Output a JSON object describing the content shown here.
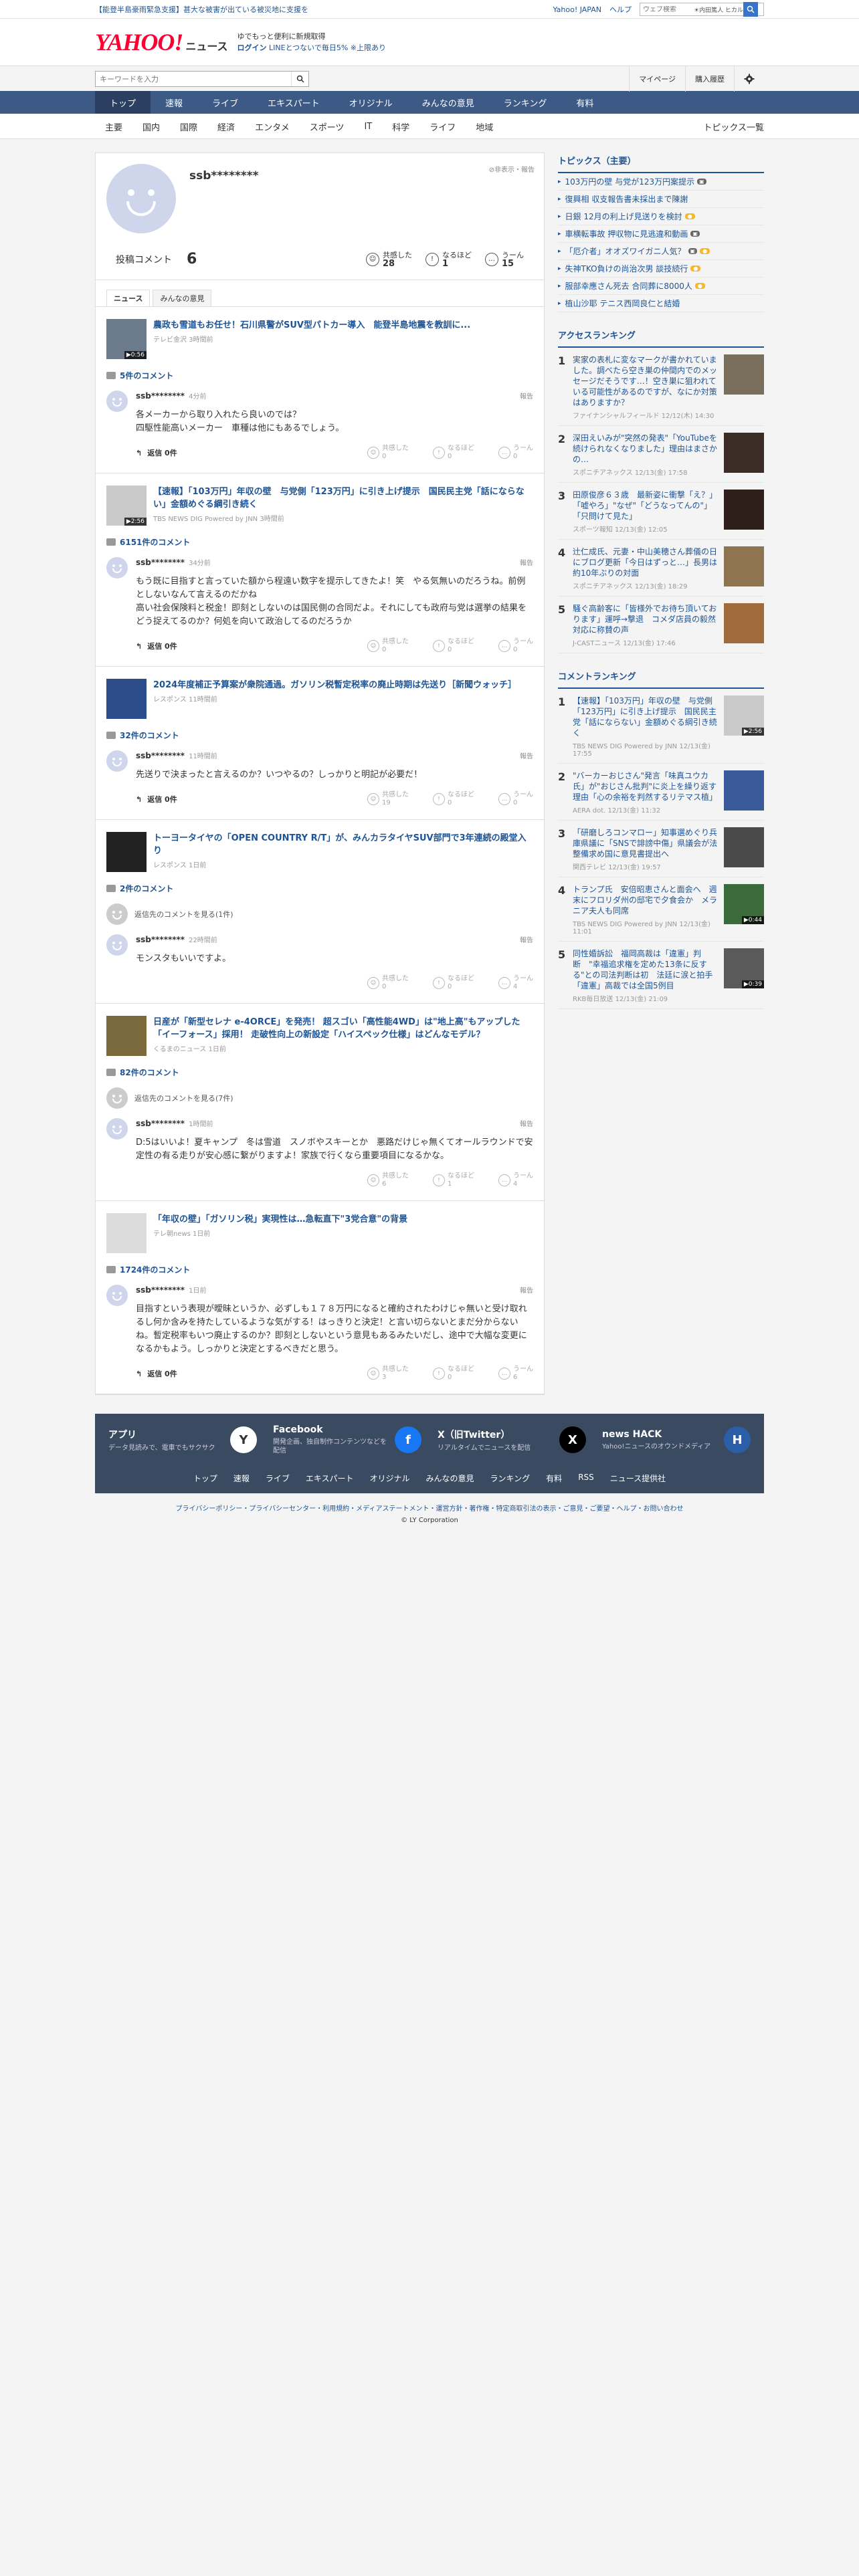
{
  "top_strip": {
    "notice": "【能登半島豪雨緊急支援】甚大な被害が出ている被災地に支援を",
    "links": [
      "Yahoo! JAPAN",
      "ヘルプ"
    ],
    "search_placeholder": "ウェブ検索",
    "search_hint": "☀内田篤人 ヒカル"
  },
  "header": {
    "logo": "YAHOO!",
    "logo_sub": "JAPAN",
    "section": "ニュース",
    "promo_line1": "ゆでもっと便利に新規取得",
    "promo_line2_login": "ログイン",
    "promo_line2": " LINEとつないで毎日5% ※上限あり"
  },
  "search": {
    "placeholder": "キーワードを入力",
    "mypage": "マイページ",
    "history": "購入履歴"
  },
  "nav": {
    "tabs": [
      "トップ",
      "速報",
      "ライブ",
      "エキスパート",
      "オリジナル",
      "みんなの意見",
      "ランキング",
      "有料"
    ],
    "active": "トップ"
  },
  "subnav": {
    "items": [
      "主要",
      "国内",
      "国際",
      "経済",
      "エンタメ",
      "スポーツ",
      "IT",
      "科学",
      "ライフ",
      "地域"
    ],
    "all": "トピックス一覧"
  },
  "profile": {
    "username": "ssb********",
    "report": "⊘非表示・報告",
    "posted_label": "投稿コメント",
    "posted_count": "6",
    "reactions": [
      {
        "label": "共感した",
        "count": "28"
      },
      {
        "label": "なるほど",
        "count": "1"
      },
      {
        "label": "うーん",
        "count": "15"
      }
    ],
    "tabs": [
      "ニュース",
      "みんなの意見"
    ]
  },
  "entries": [
    {
      "title": "農政も雪道もお任せ！石川県警がSUV型パトカー導入　能登半島地震を教訓に...",
      "source": "テレビ金沢 3時間前",
      "video": "▶0:56",
      "comment_count": "5件のコメント",
      "more_replies": "",
      "user": "ssb********",
      "time": "4分前",
      "report": "報告",
      "text": "各メーカーから取り入れたら良いのでは？\n四駆性能高いメーカー　車種は他にもあるでしょう。",
      "reply": "返信 0件",
      "votes": [
        "共感した\n0",
        "なるほど\n0",
        "うーん\n0"
      ],
      "thumb": "#6b7b8c"
    },
    {
      "title": "【速報】「103万円」年収の壁　与党側「123万円」に引き上げ提示　国民民主党「話にならない」金額めぐる綱引き続く",
      "source": "TBS NEWS DIG Powered by JNN 3時間前",
      "video": "▶2:56",
      "comment_count": "6151件のコメント",
      "more_replies": "",
      "user": "ssb********",
      "time": "34分前",
      "report": "報告",
      "text": "もう既に目指すと言っていた額から程遠い数字を提示してきたよ！笑　やる気無いのだろうね。前例としないなんて言えるのだかね\n高い社会保険料と税金！即刻としないのは国民側の合同だよ。それにしても政府与党は選挙の結果をどう捉えてるのか？何処を向いて政治してるのだろうか",
      "reply": "返信 0件",
      "votes": [
        "共感した\n0",
        "なるほど\n0",
        "うーん\n0"
      ],
      "thumb": "#c9c9c9"
    },
    {
      "title": "2024年度補正予算案が衆院通過。ガソリン税暫定税率の廃止時期は先送り［新聞ウォッチ］",
      "source": "レスポンス 11時間前",
      "video": "",
      "comment_count": "32件のコメント",
      "more_replies": "",
      "user": "ssb********",
      "time": "11時間前",
      "report": "報告",
      "text": "先送りで決まったと言えるのか？いつやるの？しっかりと明記が必要だ！",
      "reply": "返信 0件",
      "votes": [
        "共感した\n19",
        "なるほど\n0",
        "うーん\n0"
      ],
      "thumb": "#2c4d8a"
    },
    {
      "title": "トーヨータイヤの「OPEN COUNTRY R/T」が、みんカラタイヤSUV部門で3年連続の殿堂入り",
      "source": "レスポンス 1日前",
      "video": "",
      "comment_count": "2件のコメント",
      "more_replies": "返信先のコメントを見る(1件)",
      "user": "ssb********",
      "time": "22時間前",
      "report": "報告",
      "text": "モンスタもいいですよ。",
      "reply": "",
      "votes": [
        "共感した\n0",
        "なるほど\n0",
        "うーん\n4"
      ],
      "thumb": "#222"
    },
    {
      "title": "日産が「新型セレナ e-4ORCE」を発売！ 超スゴい「高性能4WD」は\"地上高\"もアップした「イーフォース」採用！ 走破性向上の新設定「ハイスペック仕様」はどんなモデル？",
      "source": "くるまのニュース 1日前",
      "video": "",
      "comment_count": "82件のコメント",
      "more_replies": "返信先のコメントを見る(7件)",
      "user": "ssb********",
      "time": "1時間前",
      "report": "報告",
      "text": "D:5はいいよ！夏キャンプ　冬は雪道　スノボやスキーとか　悪路だけじゃ無くてオールラウンドで安定性の有る走りが安心感に繋がりますよ！家族で行くなら重要項目になるかな。",
      "reply": "",
      "votes": [
        "共感した\n6",
        "なるほど\n1",
        "うーん\n4"
      ],
      "thumb": "#7a6a3e"
    },
    {
      "title": "「年収の壁」「ガソリン税」実現性は…急転直下\"3党合意\"の背景",
      "source": "テレ朝news 1日前",
      "video": "",
      "comment_count": "1724件のコメント",
      "more_replies": "",
      "user": "ssb********",
      "time": "1日前",
      "report": "報告",
      "text": "目指すという表現が曖昧というか、必ずしも１７８万円になると確約されたわけじゃ無いと受け取れるし何か含みを持たしているような気がする！はっきりと決定！と言い切らないとまだ分からないね。暫定税率もいつ廃止するのか？即刻としないという意見もあるみたいだし、途中で大幅な変更になるかもよう。しっかりと決定とするべきだと思う。",
      "reply": "返信 0件",
      "votes": [
        "共感した\n3",
        "なるほど\n0",
        "うーん\n6"
      ],
      "thumb": "#dcdcdc"
    }
  ],
  "sidebar": {
    "topics_title": "トピックス（主要）",
    "topics": [
      {
        "text": "103万円の壁 与党が123万円案提示",
        "badge": "cam"
      },
      {
        "text": "復興相 収支報告書未採出まで陳謝",
        "badge": ""
      },
      {
        "text": "日銀 12月の利上げ見送りを検討",
        "badge": "new"
      },
      {
        "text": "車横転事故 押収物に見逃違和動画",
        "badge": "cam"
      },
      {
        "text": "「厄介者」オオズワイガニ人気？",
        "badge": "cam new"
      },
      {
        "text": "失神TKO負けの尚治次男 談技続行",
        "badge": "new"
      },
      {
        "text": "服部幸應さん死去 合同葬に8000人",
        "badge": "new"
      },
      {
        "text": "植山沙耶 テニス西岡良仁と結婚",
        "badge": ""
      }
    ],
    "access_title": "アクセスランキング",
    "access": [
      {
        "n": "1",
        "t": "実家の表札に変なマークが書かれていました。調べたら空き巣の仲間内でのメッセージだそうです…！空き巣に狙われている可能性があるのですが、なにか対策はありますか？",
        "s": "ファイナンシャルフィールド 12/12(木) 14:30",
        "c": "#7a6e5d"
      },
      {
        "n": "2",
        "t": "深田えいみが\"突然の発表\"「YouTubeを続けられなくなりました」理由はまさかの…",
        "s": "スポニチアネックス 12/13(金) 17:58",
        "c": "#3b2c26"
      },
      {
        "n": "3",
        "t": "田原俊彦６３歳　最新姿に衝撃「え？」「嘘やろ」\"なぜ\"「どうなってんの\"」「只問けて見た」",
        "s": "スポーツ報知 12/13(金) 12:05",
        "c": "#2f1f1a"
      },
      {
        "n": "4",
        "t": "辻仁成氏、元妻・中山美穂さん葬儀の日にブログ更新「今日はずっと…」長男は約10年ぶりの対面",
        "s": "スポニチアネックス 12/13(金) 18:29",
        "c": "#8e7450"
      },
      {
        "n": "5",
        "t": "騒ぐ高齢客に「皆様外でお待ち頂いております」運呼→撃退　コメダ店員の毅然対応に称賛の声",
        "s": "J-CASTニュース 12/13(金) 17:46",
        "c": "#a06a3b"
      }
    ],
    "comment_title": "コメントランキング",
    "comments": [
      {
        "n": "1",
        "t": "【速報】「103万円」年収の壁　与党側「123万円」に引き上げ提示　国民民主党「話にならない」金額めぐる綱引き続く",
        "s": "TBS NEWS DIG Powered by JNN 12/13(金) 17:55",
        "c": "#c9c9c9",
        "v": "▶2:56"
      },
      {
        "n": "2",
        "t": "\"バーカーおじさん\"発言「味真ユウカ氏」が\"おじさん批判\"に炎上を繰り返す理由「心の余裕を判然するリテマス植」",
        "s": "AERA dot. 12/13(金) 11:32",
        "c": "#3b5a9a",
        "v": ""
      },
      {
        "n": "3",
        "t": "「研磨しろコンマロー」知事選めぐり兵庫県議に「SNSで誹謗中傷」県議会が法整備求め国に意見書提出へ",
        "s": "関西テレビ 12/13(金) 19:57",
        "c": "#4a4a4a",
        "v": ""
      },
      {
        "n": "4",
        "t": "トランプ氏　安倍昭恵さんと面会へ　週末にフロリダ州の邸宅で夕食会か　メラニア夫人も同席",
        "s": "TBS NEWS DIG Powered by JNN 12/13(金) 11:01",
        "c": "#3b6a3b",
        "v": "▶0:44"
      },
      {
        "n": "5",
        "t": "同性婚訴訟　福岡高裁は「違憲」判断　\"幸福追求権を定めた13条に反する\"との司法判断は初　法廷に涙と拍手「違憲」高裁では全国5例目",
        "s": "RKB毎日放送 12/13(金) 21:09",
        "c": "#5a5a5a",
        "v": "▶0:39"
      }
    ]
  },
  "footer": {
    "cards": [
      {
        "title": "アプリ",
        "desc": "データ見読みで、電車でもサクサク",
        "icon": "Y"
      },
      {
        "title": "Facebook",
        "desc": "開発企画、独自制作コンテンツなどを配信",
        "icon": "f"
      },
      {
        "title": "X（旧Twitter）",
        "desc": "リアルタイムでニュースを配信",
        "icon": "X"
      },
      {
        "title": "news HACK",
        "desc": "Yahoo!ニュースのオウンドメディア",
        "icon": "H"
      }
    ],
    "nav": [
      "トップ",
      "速報",
      "ライブ",
      "エキスパート",
      "オリジナル",
      "みんなの意見",
      "ランキング",
      "有料",
      "RSS",
      "ニュース提供社"
    ],
    "legal": "プライバシーポリシー・プライバシーセンター・利用規約・メディアステートメント・運営方針・著作権・特定商取引法の表示・ご意見・ご要望・ヘルプ・お問い合わせ",
    "copyright": "© LY Corporation"
  }
}
